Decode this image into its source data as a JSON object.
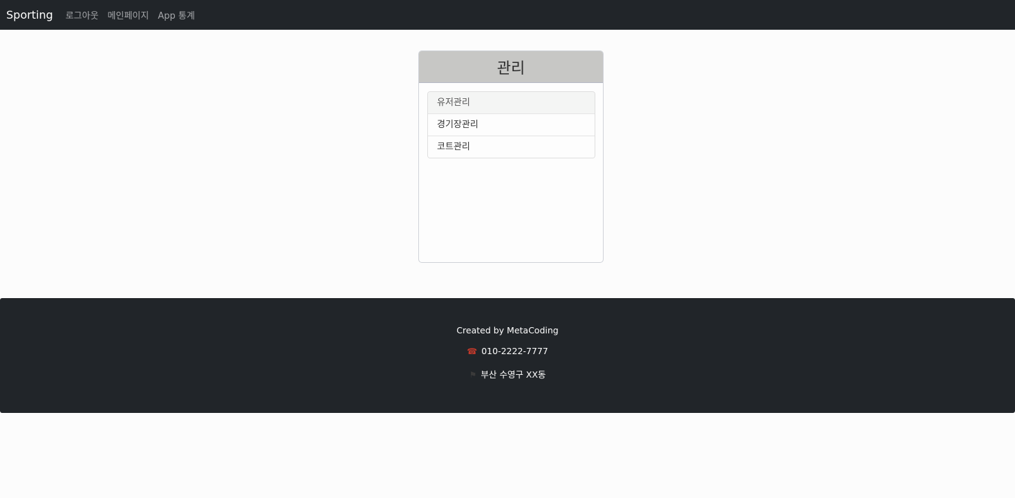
{
  "navbar": {
    "brand": "Sporting",
    "links": [
      "로그아웃",
      "메인페이지",
      "App 통계"
    ]
  },
  "card": {
    "title": "관리",
    "items": [
      {
        "label": "유저관리",
        "active": true
      },
      {
        "label": "경기장관리",
        "active": false
      },
      {
        "label": "코트관리",
        "active": false
      }
    ]
  },
  "footer": {
    "created_by": "Created by MetaCoding",
    "phone": "010-2222-7777",
    "address": "부산 수영구 XX동",
    "phone_icon": "phone-icon",
    "address_icon": "flag-icon"
  },
  "colors": {
    "navbar_bg": "#212529",
    "footer_bg": "#212529",
    "card_header_bg": "#c7c7c5"
  }
}
